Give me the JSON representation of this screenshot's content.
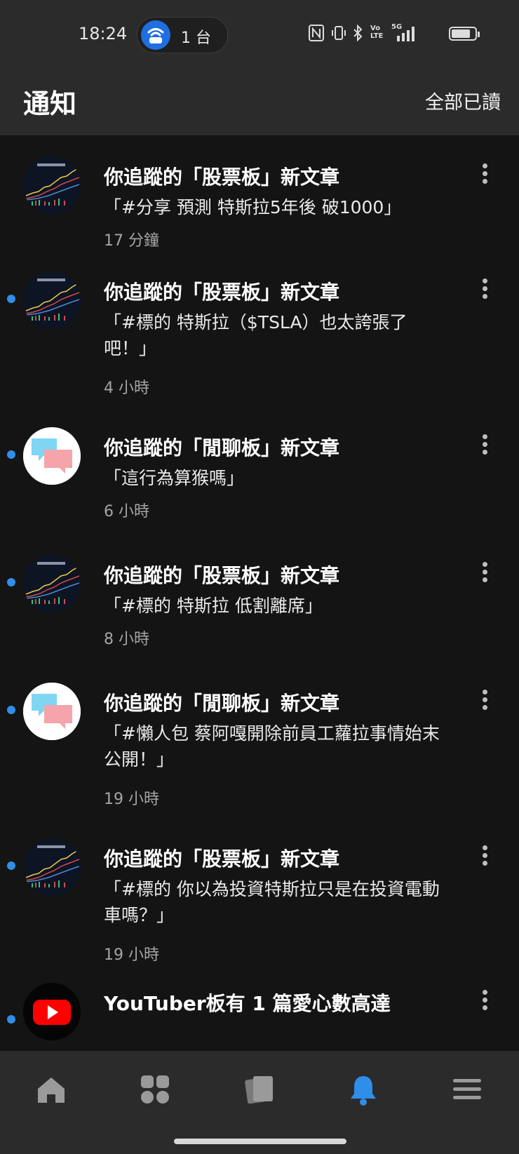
{
  "status_bar": {
    "time": "18:24",
    "hotspot_count": "1 台",
    "icons": [
      "nfc-icon",
      "vibrate-icon",
      "bluetooth-icon",
      "volte-icon",
      "5g-signal-icon",
      "battery-icon"
    ],
    "volte_label": "Vo LTE",
    "network_label": "5G"
  },
  "header": {
    "title": "通知",
    "mark_all_read": "全部已讀"
  },
  "notifications": [
    {
      "title": "你追蹤的「股票板」新文章",
      "body": "「#分享 預測 特斯拉5年後 破1000」",
      "time": "17 分鐘",
      "unread": false,
      "avatar": "stock-chart-avatar"
    },
    {
      "title": "你追蹤的「股票板」新文章",
      "body": "「#標的 特斯拉（$TSLA）也太誇張了吧！」",
      "time": "4 小時",
      "unread": true,
      "avatar": "stock-chart-avatar"
    },
    {
      "title": "你追蹤的「閒聊板」新文章",
      "body": "「這行為算猴嗎」",
      "time": "6 小時",
      "unread": true,
      "avatar": "chat-bubbles-avatar"
    },
    {
      "title": "你追蹤的「股票板」新文章",
      "body": "「#標的 特斯拉 低割離席」",
      "time": "8 小時",
      "unread": true,
      "avatar": "stock-chart-avatar"
    },
    {
      "title": "你追蹤的「閒聊板」新文章",
      "body": "「#懶人包 蔡阿嘎開除前員工蘿拉事情始末公開！」",
      "time": "19 小時",
      "unread": true,
      "avatar": "chat-bubbles-avatar"
    },
    {
      "title": "你追蹤的「股票板」新文章",
      "body": "「#標的 你以為投資特斯拉只是在投資電動車嗎？」",
      "time": "19 小時",
      "unread": true,
      "avatar": "stock-chart-avatar"
    },
    {
      "title": "YouTuber板有 1 篇愛心數高達",
      "body": "",
      "time": "",
      "unread": true,
      "avatar": "youtube-avatar"
    }
  ],
  "bottom_nav": [
    {
      "icon": "home-icon",
      "active": false
    },
    {
      "icon": "boards-grid-icon",
      "active": false
    },
    {
      "icon": "cards-icon",
      "active": false
    },
    {
      "icon": "bell-icon",
      "active": true
    },
    {
      "icon": "menu-icon",
      "active": false
    }
  ],
  "colors": {
    "background": "#141414",
    "bar": "#2b2b2b",
    "accent": "#2f8ee8",
    "secondary_text": "#a5a5a5"
  }
}
